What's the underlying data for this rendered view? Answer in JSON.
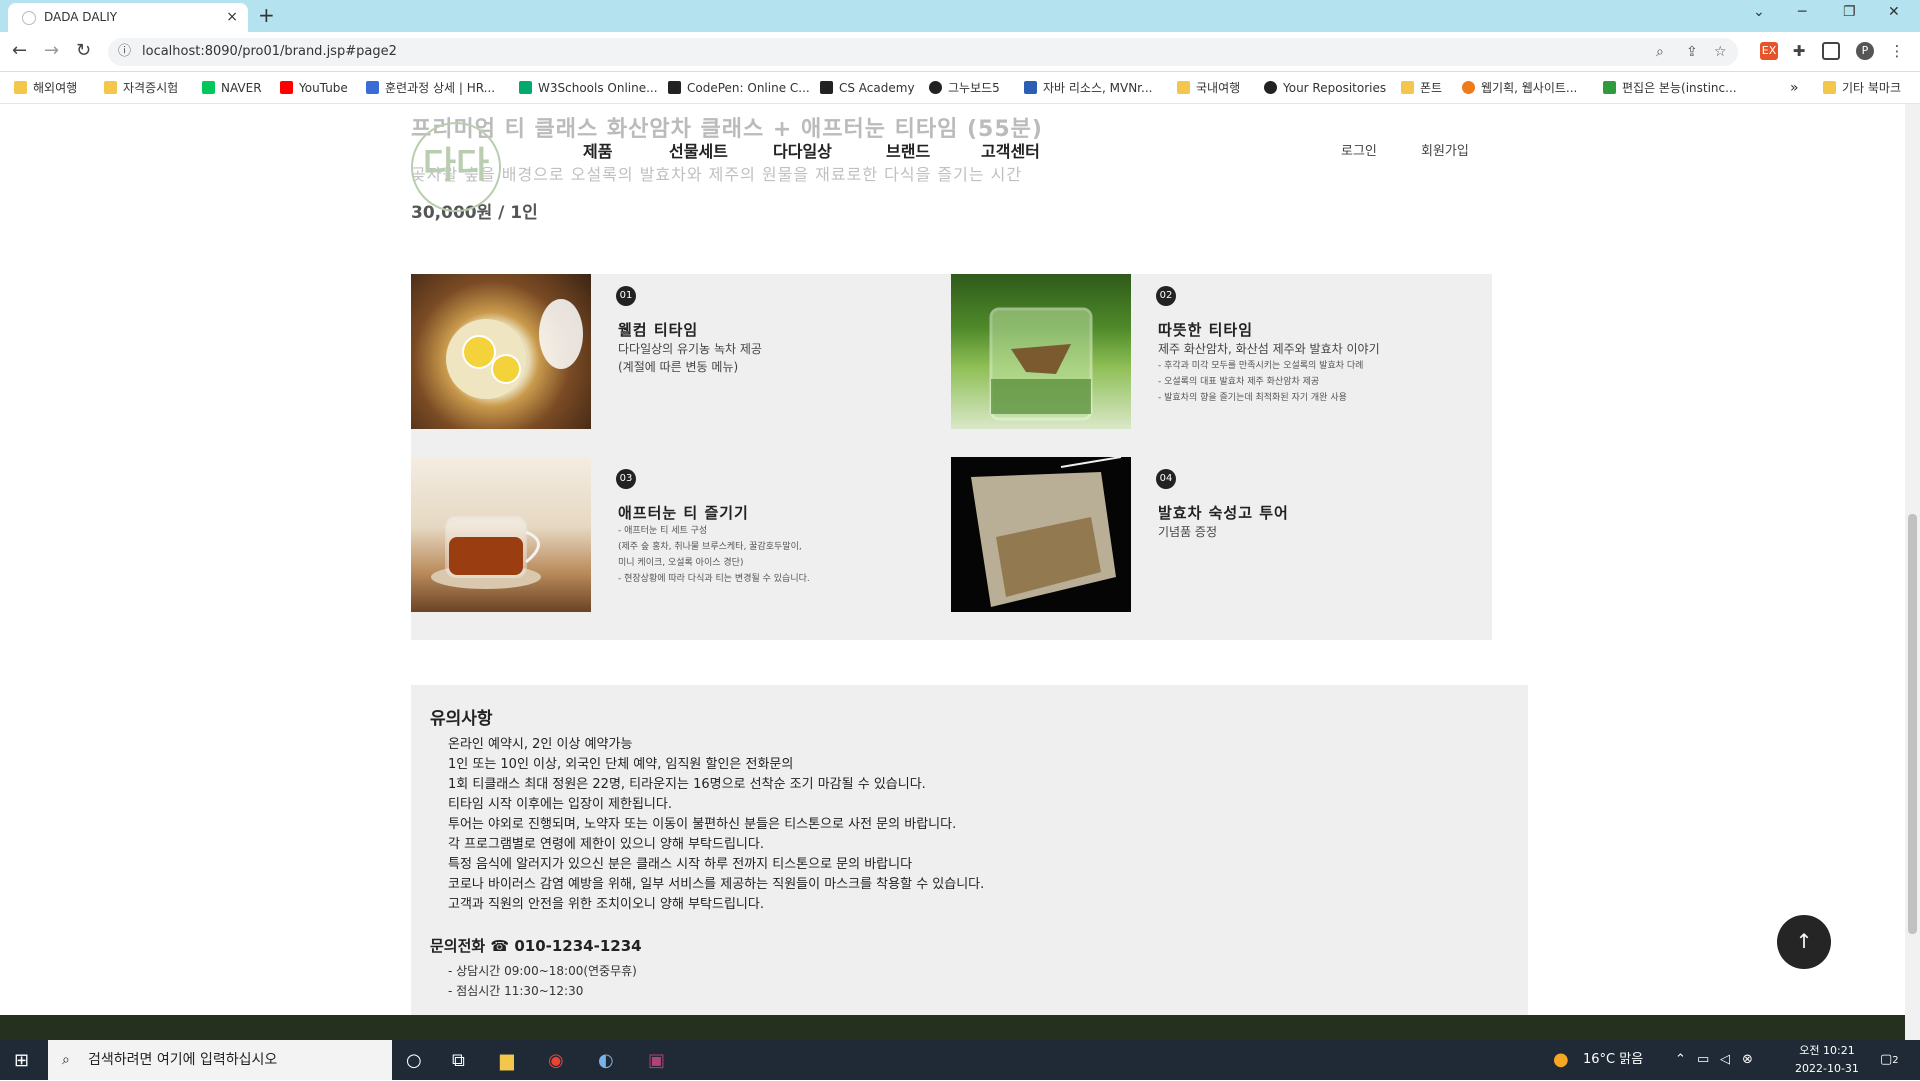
{
  "browser": {
    "tab_title": "DADA DALIY",
    "tab_close": "×",
    "new_tab": "+",
    "url": "localhost:8090/pro01/brand.jsp#page2",
    "back": "←",
    "forward": "→",
    "reload": "↻",
    "win_min": "─",
    "win_max": "❐",
    "win_close": "✕",
    "chevron": "⌄"
  },
  "bookmarks": [
    {
      "label": "해외여행",
      "color": "#f3c64c"
    },
    {
      "label": "자격증시험",
      "color": "#f3c64c"
    },
    {
      "label": "NAVER",
      "color": "#03c75a"
    },
    {
      "label": "YouTube",
      "color": "#ff0000"
    },
    {
      "label": "훈련과정 상세 | HR...",
      "color": "#3a6bd6"
    },
    {
      "label": "W3Schools Online...",
      "color": "#04aa6d"
    },
    {
      "label": "CodePen: Online C...",
      "color": "#222222"
    },
    {
      "label": "CS Academy",
      "color": "#222222"
    },
    {
      "label": "그누보드5",
      "color": "#222222"
    },
    {
      "label": "자바 리소스, MVNr...",
      "color": "#2b5fb4"
    },
    {
      "label": "국내여행",
      "color": "#f3c64c"
    },
    {
      "label": "Your Repositories",
      "color": "#222222"
    },
    {
      "label": "폰트",
      "color": "#f3c64c"
    },
    {
      "label": "웹기획, 웹사이트...",
      "color": "#f07a1a"
    },
    {
      "label": "편집은 본능(instinc...",
      "color": "#2e9c3e"
    },
    {
      "label": "»",
      "color": ""
    },
    {
      "label": "기타 북마크",
      "color": "#f3c64c"
    }
  ],
  "page": {
    "faded_title": "프리미엄 티 클래스 화산암차 클래스 + 애프터눈 티타임 (55분)",
    "faded_sub": "곶자왈 숲을 배경으로 오설록의 발효차와 제주의 원물을 재료로한 다식을 즐기는 시간",
    "price": "30,000원 / 1인",
    "logo_text": "다다",
    "nav": [
      "제품",
      "선물세트",
      "다다일상",
      "브랜드",
      "고객센터"
    ],
    "login": "로그인",
    "signup": "회원가입"
  },
  "program": [
    {
      "num": "01",
      "title": "웰컴 티타임",
      "desc": [
        "다다일상의 유기농 녹차 제공",
        "(계절에 따른 변동 메뉴)"
      ],
      "small": []
    },
    {
      "num": "02",
      "title": "따뜻한 티타임",
      "desc": [
        "제주 화산암차, 화산섬 제주와 발효차 이야기"
      ],
      "small": [
        "- 후각과 미각 모두를 만족시키는 오설록의 발효차 다례",
        "- 오설록의 대표 발효차 제주 화산암차 제공",
        "- 발효차의 향을 즐기는데 최적화된 자기 개완 사용"
      ]
    },
    {
      "num": "03",
      "title": "애프터눈 티 즐기기",
      "desc": [],
      "small": [
        "- 애프터눈 티 세트 구성",
        "(제주 숲 홍차, 취나물 브루스케타, 꿀감호두말이,",
        "미니 케이크, 오설록 아이스 경단)",
        "- 현장상황에 따라 다식과 티는 변경될 수 있습니다."
      ]
    },
    {
      "num": "04",
      "title": "발효차 숙성고 투어",
      "desc": [
        "기념품 증정"
      ],
      "small": []
    }
  ],
  "notice": {
    "title": "유의사항",
    "lines": [
      "온라인 예약시, 2인 이상 예약가능",
      "1인 또는 10인 이상, 외국인 단체 예약, 임직원 할인은 전화문의",
      "1회 티클래스 최대 정원은 22명, 티라운지는 16명으로 선착순 조기 마감될 수 있습니다.",
      "티타임 시작 이후에는 입장이 제한됩니다.",
      "투어는 야외로 진행되며, 노약자 또는 이동이 불편하신 분들은 티스톤으로 사전 문의 바랍니다.",
      "각 프로그램별로 연령에 제한이 있으니 양해 부탁드립니다.",
      "특정 음식에 알러지가 있으신 분은 클래스 시작 하루 전까지 티스톤으로 문의 바랍니다",
      "코로나 바이러스 감염 예방을 위해, 일부 서비스를 제공하는 직원들이 마스크를 착용할 수 있습니다.",
      "고객과 직원의 안전을 위한 조치이오니 양해 부탁드립니다."
    ],
    "phone": "문의전화 ☎ 010-1234-1234",
    "hours": [
      "- 상담시간 09:00~18:00(연중무휴)",
      "- 점심시간 11:30~12:30"
    ]
  },
  "top_button": "↑",
  "taskbar": {
    "search_placeholder": "검색하려면 여기에 입력하십시오",
    "weather": "16°C 맑음",
    "time": "오전 10:21",
    "date": "2022-10-31",
    "notif_count": "2"
  }
}
